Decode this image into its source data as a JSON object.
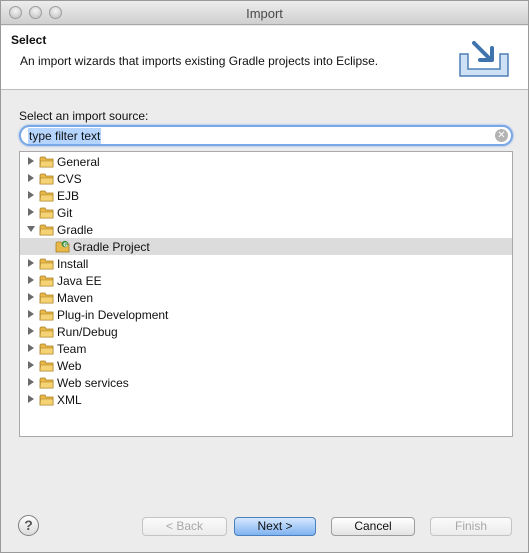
{
  "window": {
    "title": "Import"
  },
  "header": {
    "title": "Select",
    "description": "An import wizards that imports existing Gradle projects into Eclipse."
  },
  "source": {
    "label": "Select an import source:",
    "filter_placeholder": "type filter text",
    "filter_value": "type filter text"
  },
  "tree": {
    "items": [
      {
        "label": "General",
        "expanded": false,
        "level": 0,
        "selected": false
      },
      {
        "label": "CVS",
        "expanded": false,
        "level": 0,
        "selected": false
      },
      {
        "label": "EJB",
        "expanded": false,
        "level": 0,
        "selected": false
      },
      {
        "label": "Git",
        "expanded": false,
        "level": 0,
        "selected": false
      },
      {
        "label": "Gradle",
        "expanded": true,
        "level": 0,
        "selected": false
      },
      {
        "label": "Gradle Project",
        "expanded": null,
        "level": 1,
        "selected": true
      },
      {
        "label": "Install",
        "expanded": false,
        "level": 0,
        "selected": false
      },
      {
        "label": "Java EE",
        "expanded": false,
        "level": 0,
        "selected": false
      },
      {
        "label": "Maven",
        "expanded": false,
        "level": 0,
        "selected": false
      },
      {
        "label": "Plug-in Development",
        "expanded": false,
        "level": 0,
        "selected": false
      },
      {
        "label": "Run/Debug",
        "expanded": false,
        "level": 0,
        "selected": false
      },
      {
        "label": "Team",
        "expanded": false,
        "level": 0,
        "selected": false
      },
      {
        "label": "Web",
        "expanded": false,
        "level": 0,
        "selected": false
      },
      {
        "label": "Web services",
        "expanded": false,
        "level": 0,
        "selected": false
      },
      {
        "label": "XML",
        "expanded": false,
        "level": 0,
        "selected": false
      }
    ]
  },
  "buttons": {
    "help": "?",
    "back": "< Back",
    "next": "Next >",
    "cancel": "Cancel",
    "finish": "Finish"
  },
  "colors": {
    "selection": "#dcdcdc",
    "folder": "#e8b84a",
    "default_button": "#7fb2f0"
  }
}
